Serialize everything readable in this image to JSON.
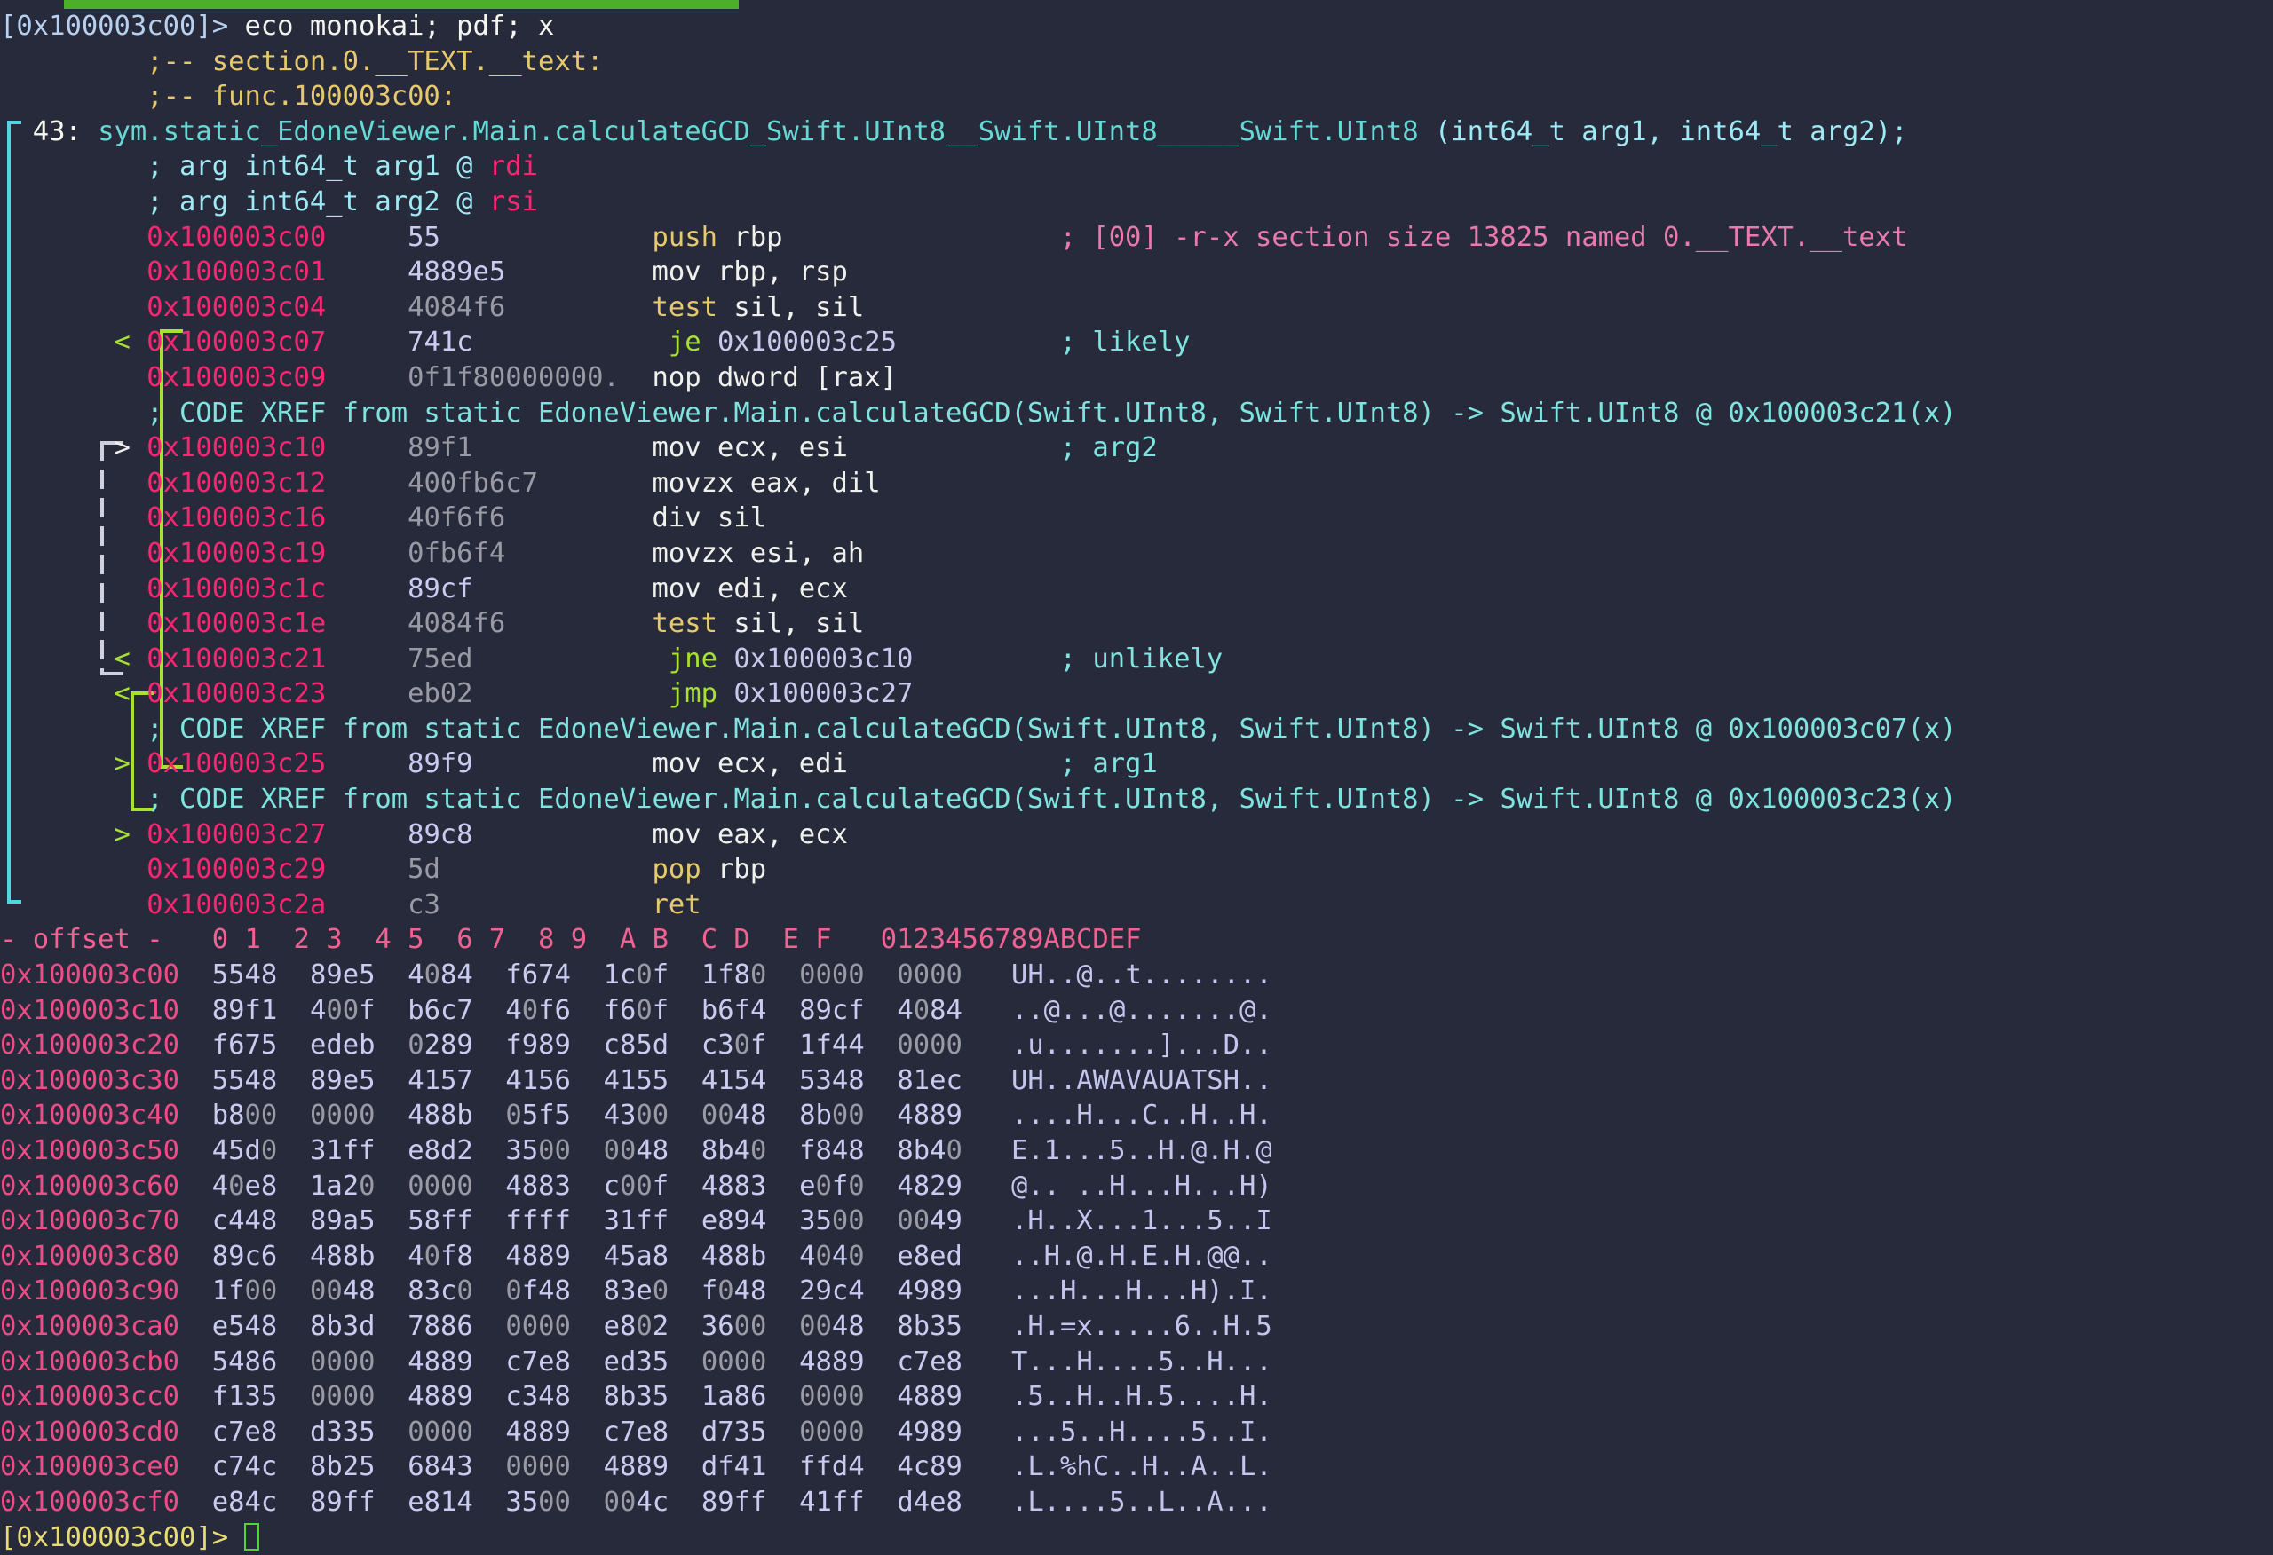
{
  "app": {
    "name": "radare2",
    "kind": "terminal-disassembler",
    "background": "#272a3a"
  },
  "topbar": {
    "color": "#4caf2a"
  },
  "input_line": {
    "prompt": "[0x100003c00]>",
    "command": " eco monokai; pdf; x"
  },
  "header_comments": [
    ";-- section.0.__TEXT.__text:",
    ";-- func.100003c00:"
  ],
  "function": {
    "num": "43:",
    "signature": "sym.static_EdoneViewer.Main.calculateGCD_Swift.UInt8__Swift.UInt8_____Swift.UInt8",
    "params": " (int64_t arg1, int64_t arg2);",
    "args": [
      {
        "text": "; arg int64_t arg1 @ ",
        "reg": "rdi"
      },
      {
        "text": "; arg int64_t arg2 @ ",
        "reg": "rsi"
      }
    ]
  },
  "disasm": [
    {
      "addr": "0x100003c00",
      "bytes": "55",
      "mnem": "push",
      "mtype": "y",
      "ops": " rbp",
      "comment": "; [00] -r-x section size 13825 named 0.__TEXT.__text",
      "ctype": "pink",
      "flow": ""
    },
    {
      "addr": "0x100003c01",
      "bytes": "4889e5",
      "mnem": "mov",
      "mtype": "w",
      "ops": " rbp, rsp",
      "comment": "",
      "ctype": "",
      "flow": ""
    },
    {
      "addr": "0x100003c04",
      "bytes": "4084f6",
      "mnem": "test",
      "mtype": "y",
      "ops": " sil, sil",
      "comment": "",
      "ctype": "",
      "flow": ""
    },
    {
      "addr": "0x100003c07",
      "bytes": "741c",
      "mnem": "je",
      "mtype": "j",
      "ops": " 0x100003c25",
      "comment": "; likely",
      "ctype": "cyan",
      "flow": "<"
    },
    {
      "addr": "0x100003c09",
      "bytes": "0f1f80000000.",
      "mnem": "nop",
      "mtype": "w",
      "ops": " dword [rax]",
      "comment": "",
      "ctype": "",
      "flow": ""
    },
    {
      "xref": "; CODE XREF from static EdoneViewer.Main.calculateGCD(Swift.UInt8, Swift.UInt8) -> Swift.UInt8 @ 0x100003c21(x)"
    },
    {
      "addr": "0x100003c10",
      "bytes": "89f1",
      "mnem": "mov",
      "mtype": "w",
      "ops": " ecx, esi",
      "comment": "; arg2",
      "ctype": "cyan",
      "flow": ">"
    },
    {
      "addr": "0x100003c12",
      "bytes": "400fb6c7",
      "mnem": "movzx",
      "mtype": "w",
      "ops": " eax, dil",
      "comment": "",
      "ctype": "",
      "flow": ""
    },
    {
      "addr": "0x100003c16",
      "bytes": "40f6f6",
      "mnem": "div",
      "mtype": "w",
      "ops": " sil",
      "comment": "",
      "ctype": "",
      "flow": ""
    },
    {
      "addr": "0x100003c19",
      "bytes": "0fb6f4",
      "mnem": "movzx",
      "mtype": "w",
      "ops": " esi, ah",
      "comment": "",
      "ctype": "",
      "flow": ""
    },
    {
      "addr": "0x100003c1c",
      "bytes": "89cf",
      "mnem": "mov",
      "mtype": "w",
      "ops": " edi, ecx",
      "comment": "",
      "ctype": "",
      "flow": ""
    },
    {
      "addr": "0x100003c1e",
      "bytes": "4084f6",
      "mnem": "test",
      "mtype": "y",
      "ops": " sil, sil",
      "comment": "",
      "ctype": "",
      "flow": ""
    },
    {
      "addr": "0x100003c21",
      "bytes": "75ed",
      "mnem": "jne",
      "mtype": "j",
      "ops": " 0x100003c10",
      "comment": "; unlikely",
      "ctype": "cyan",
      "flow": "<"
    },
    {
      "addr": "0x100003c23",
      "bytes": "eb02",
      "mnem": "jmp",
      "mtype": "j",
      "ops": " 0x100003c27",
      "comment": "",
      "ctype": "",
      "flow": "<"
    },
    {
      "xref": "; CODE XREF from static EdoneViewer.Main.calculateGCD(Swift.UInt8, Swift.UInt8) -> Swift.UInt8 @ 0x100003c07(x)"
    },
    {
      "addr": "0x100003c25",
      "bytes": "89f9",
      "mnem": "mov",
      "mtype": "w",
      "ops": " ecx, edi",
      "comment": "; arg1",
      "ctype": "cyan",
      "flow": ">"
    },
    {
      "xref": "; CODE XREF from static EdoneViewer.Main.calculateGCD(Swift.UInt8, Swift.UInt8) -> Swift.UInt8 @ 0x100003c23(x)"
    },
    {
      "addr": "0x100003c27",
      "bytes": "89c8",
      "mnem": "mov",
      "mtype": "w",
      "ops": " eax, ecx",
      "comment": "",
      "ctype": "",
      "flow": ">"
    },
    {
      "addr": "0x100003c29",
      "bytes": "5d",
      "mnem": "pop",
      "mtype": "y",
      "ops": " rbp",
      "comment": "",
      "ctype": "",
      "flow": ""
    },
    {
      "addr": "0x100003c2a",
      "bytes": "c3",
      "mnem": "ret",
      "mtype": "y",
      "ops": "",
      "comment": "",
      "ctype": "",
      "flow": ""
    }
  ],
  "hexdump": {
    "header_offset": "- offset -",
    "header_cols": [
      "0 1",
      "2 3",
      "4 5",
      "6 7",
      "8 9",
      "A B",
      "C D",
      "E F"
    ],
    "header_ascii": "0123456789ABCDEF",
    "rows": [
      {
        "offset": "0x100003c00",
        "groups": [
          "5548",
          "89e5",
          "4084",
          "f674",
          "1c0f",
          "1f80",
          "0000",
          "0000"
        ],
        "ascii": "UH..@..t........"
      },
      {
        "offset": "0x100003c10",
        "groups": [
          "89f1",
          "400f",
          "b6c7",
          "40f6",
          "f60f",
          "b6f4",
          "89cf",
          "4084"
        ],
        "ascii": "..@...@.......@."
      },
      {
        "offset": "0x100003c20",
        "groups": [
          "f675",
          "edeb",
          "0289",
          "f989",
          "c85d",
          "c30f",
          "1f44",
          "0000"
        ],
        "ascii": ".u.......]...D.."
      },
      {
        "offset": "0x100003c30",
        "groups": [
          "5548",
          "89e5",
          "4157",
          "4156",
          "4155",
          "4154",
          "5348",
          "81ec"
        ],
        "ascii": "UH..AWAVAUATSH.."
      },
      {
        "offset": "0x100003c40",
        "groups": [
          "b800",
          "0000",
          "488b",
          "05f5",
          "4300",
          "0048",
          "8b00",
          "4889"
        ],
        "ascii": "....H...C..H..H."
      },
      {
        "offset": "0x100003c50",
        "groups": [
          "45d0",
          "31ff",
          "e8d2",
          "3500",
          "0048",
          "8b40",
          "f848",
          "8b40"
        ],
        "ascii": "E.1...5..H.@.H.@"
      },
      {
        "offset": "0x100003c60",
        "groups": [
          "40e8",
          "1a20",
          "0000",
          "4883",
          "c00f",
          "4883",
          "e0f0",
          "4829"
        ],
        "ascii": "@.. ..H...H...H)"
      },
      {
        "offset": "0x100003c70",
        "groups": [
          "c448",
          "89a5",
          "58ff",
          "ffff",
          "31ff",
          "e894",
          "3500",
          "0049"
        ],
        "ascii": ".H..X...1...5..I"
      },
      {
        "offset": "0x100003c80",
        "groups": [
          "89c6",
          "488b",
          "40f8",
          "4889",
          "45a8",
          "488b",
          "4040",
          "e8ed"
        ],
        "ascii": "..H.@.H.E.H.@@.."
      },
      {
        "offset": "0x100003c90",
        "groups": [
          "1f00",
          "0048",
          "83c0",
          "0f48",
          "83e0",
          "f048",
          "29c4",
          "4989"
        ],
        "ascii": "...H...H...H).I."
      },
      {
        "offset": "0x100003ca0",
        "groups": [
          "e548",
          "8b3d",
          "7886",
          "0000",
          "e802",
          "3600",
          "0048",
          "8b35"
        ],
        "ascii": ".H.=x.....6..H.5"
      },
      {
        "offset": "0x100003cb0",
        "groups": [
          "5486",
          "0000",
          "4889",
          "c7e8",
          "ed35",
          "0000",
          "4889",
          "c7e8"
        ],
        "ascii": "T...H....5..H..."
      },
      {
        "offset": "0x100003cc0",
        "groups": [
          "f135",
          "0000",
          "4889",
          "c348",
          "8b35",
          "1a86",
          "0000",
          "4889"
        ],
        "ascii": ".5..H..H.5....H."
      },
      {
        "offset": "0x100003cd0",
        "groups": [
          "c7e8",
          "d335",
          "0000",
          "4889",
          "c7e8",
          "d735",
          "0000",
          "4989"
        ],
        "ascii": "...5..H....5..I."
      },
      {
        "offset": "0x100003ce0",
        "groups": [
          "c74c",
          "8b25",
          "6843",
          "0000",
          "4889",
          "df41",
          "ffd4",
          "4c89"
        ],
        "ascii": ".L.%hC..H..A..L."
      },
      {
        "offset": "0x100003cf0",
        "groups": [
          "e84c",
          "89ff",
          "e814",
          "3500",
          "004c",
          "89ff",
          "41ff",
          "d4e8"
        ],
        "ascii": ".L....5..L..A..."
      }
    ]
  },
  "bottom_prompt": {
    "prompt": "[0x100003c00]>",
    "cursor": "block"
  }
}
